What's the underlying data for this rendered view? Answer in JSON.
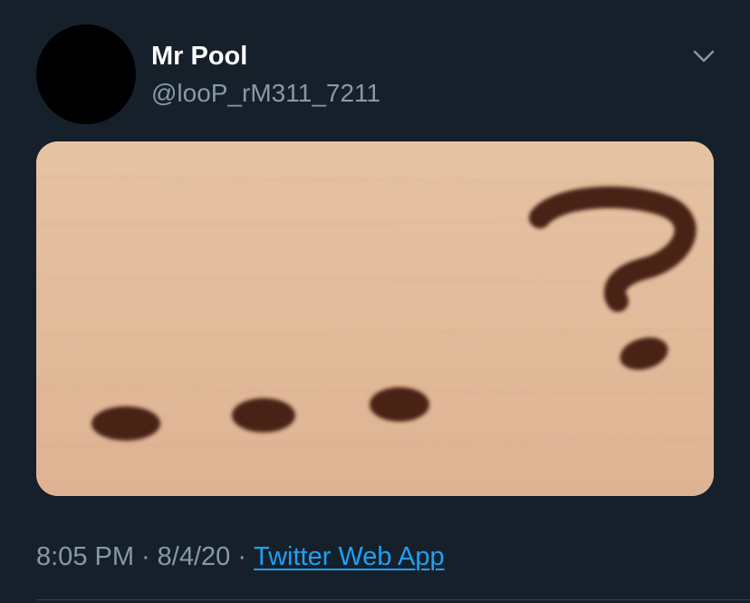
{
  "tweet": {
    "author": {
      "display_name": "Mr Pool",
      "handle": "@looP_rM311_7211"
    },
    "meta": {
      "time": "8:05 PM",
      "date": "8/4/20",
      "separator": "·",
      "source": "Twitter Web App"
    },
    "media": {
      "description_icon": "ellipsis-question-mark"
    }
  },
  "colors": {
    "background": "#15202b",
    "primary_text": "#ffffff",
    "secondary_text": "#8899a6",
    "link": "#1da1f2",
    "avatar": "#000000",
    "wood": "#e4c0a1",
    "ink": "#4a2418"
  }
}
